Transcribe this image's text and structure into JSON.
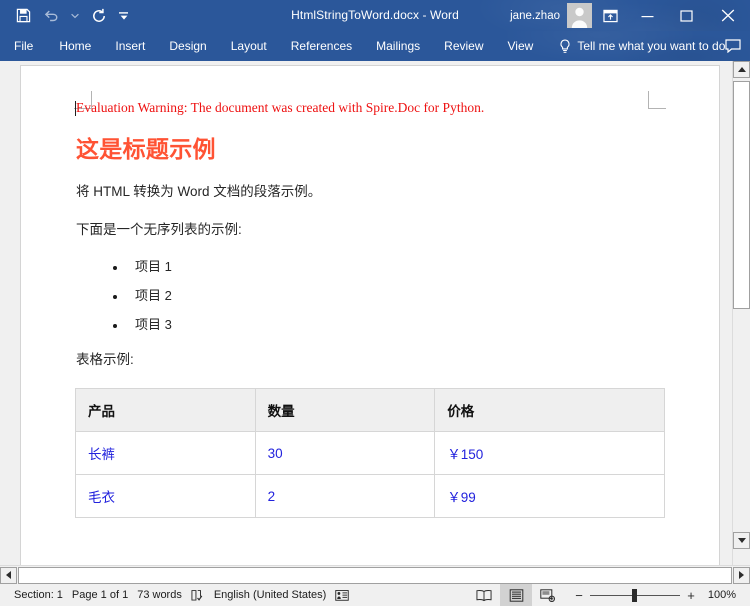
{
  "window": {
    "title": "HtmlStringToWord.docx  -  Word",
    "user": "jane.zhao",
    "quick_access": [
      {
        "name": "save",
        "label": "Save"
      },
      {
        "name": "undo",
        "label": "Undo"
      },
      {
        "name": "redo",
        "label": "Repeat"
      },
      {
        "name": "customize",
        "label": "Customize Quick Access Toolbar"
      }
    ],
    "controls": {
      "ribbon_display": "Ribbon Display Options",
      "minimize": "Minimize",
      "maximize": "Maximize",
      "close": "Close"
    },
    "accent_color": "#2b579a"
  },
  "ribbon": {
    "tabs": [
      {
        "label": "File"
      },
      {
        "label": "Home"
      },
      {
        "label": "Insert"
      },
      {
        "label": "Design"
      },
      {
        "label": "Layout"
      },
      {
        "label": "References"
      },
      {
        "label": "Mailings"
      },
      {
        "label": "Review"
      },
      {
        "label": "View"
      }
    ],
    "tell_me": "Tell me what you want to do",
    "share": "Share"
  },
  "document": {
    "evaluation_warning": "Evaluation Warning: The document was created with Spire.Doc for Python.",
    "heading": "这是标题示例",
    "paragraph_1": "将 HTML 转换为 Word 文档的段落示例。",
    "paragraph_2": "下面是一个无序列表的示例:",
    "list_items": [
      "项目 1",
      "项目 2",
      "项目 3"
    ],
    "paragraph_3": "表格示例:",
    "table": {
      "headers": [
        "产品",
        "数量",
        "价格"
      ],
      "rows": [
        [
          "长裤",
          "30",
          "￥150"
        ],
        [
          "毛衣",
          "2",
          "￥99"
        ]
      ],
      "header_bg": "#efefef",
      "cell_text_color": "#2222dd",
      "border_color": "#d6d6d6"
    },
    "colors": {
      "warning_text": "#ee1111",
      "heading_text": "#ff5334",
      "body_text": "#262626"
    }
  },
  "status_bar": {
    "section": "Section: 1",
    "page": "Page 1 of 1",
    "words": "73 words",
    "proofing": "Proofing errors",
    "language": "English (United States)",
    "accessibility": "Accessibility: investigate",
    "views": [
      {
        "name": "read-mode",
        "label": "Read Mode",
        "active": false
      },
      {
        "name": "print-layout",
        "label": "Print Layout",
        "active": true
      },
      {
        "name": "web-layout",
        "label": "Web Layout",
        "active": false
      }
    ],
    "zoom_out": "−",
    "zoom_in": "+",
    "zoom_level": "100%"
  }
}
